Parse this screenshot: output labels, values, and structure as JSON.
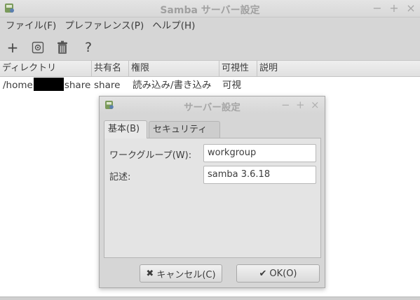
{
  "window": {
    "title": "Samba サーバー設定",
    "minimize": "−",
    "maximize": "+",
    "close": "×"
  },
  "menu": [
    {
      "label": "ファイル(F)"
    },
    {
      "label": "プレファレンス(P)"
    },
    {
      "label": "ヘルプ(H)"
    }
  ],
  "toolbar": {
    "add_icon": "plus-icon",
    "properties_icon": "properties-icon",
    "delete_icon": "trash-icon",
    "help_icon": "question-icon",
    "add_glyph": "+",
    "help_glyph": "?"
  },
  "table": {
    "columns": [
      "ディレクトリ",
      "共有名",
      "権限",
      "可視性",
      "説明"
    ],
    "rows": [
      {
        "dir_prefix": "/home",
        "dir_suffix": "share",
        "share": "share",
        "perm": "読み込み/書き込み",
        "visibility": "可視",
        "description": ""
      }
    ]
  },
  "dialog": {
    "title": "サーバー設定",
    "minimize": "−",
    "maximize": "+",
    "close": "×",
    "tabs": [
      {
        "label": "基本(B)",
        "active": true
      },
      {
        "label": "セキュリティ(S)",
        "active": false
      }
    ],
    "workgroup_label": "ワークグループ(W):",
    "workgroup_value": "workgroup",
    "description_label": "記述:",
    "description_value": "samba 3.6.18",
    "cancel_label": "キャンセル(C)",
    "cancel_glyph": "✖",
    "ok_label": "OK(O)",
    "ok_glyph": "✔"
  }
}
